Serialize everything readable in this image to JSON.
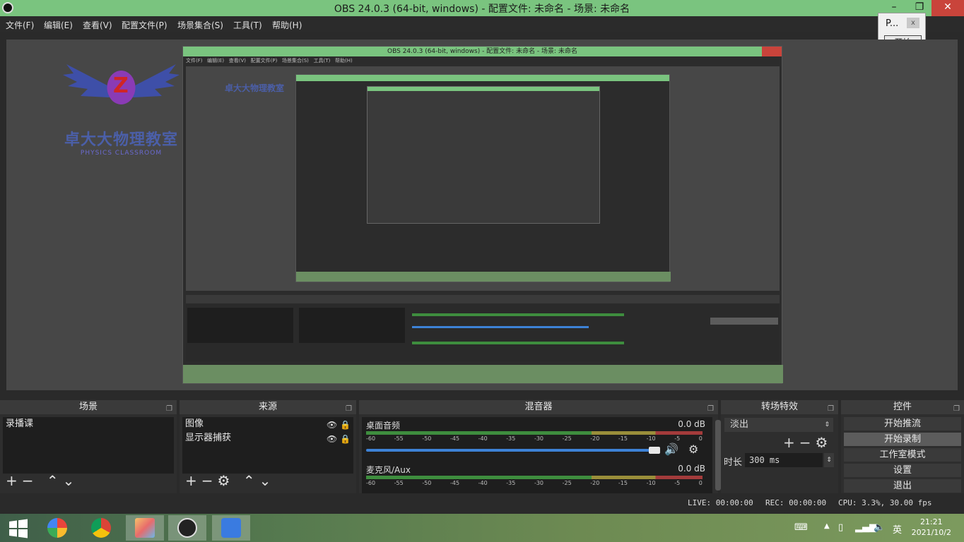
{
  "window": {
    "title": "OBS 24.0.3 (64-bit, windows) - 配置文件: 未命名 - 场景: 未命名"
  },
  "menu": [
    "文件(F)",
    "编辑(E)",
    "查看(V)",
    "配置文件(P)",
    "场景集合(S)",
    "工具(T)",
    "帮助(H)"
  ],
  "mini_window": {
    "title": "P...",
    "close": "x",
    "button": "开始"
  },
  "preview": {
    "logo_text": "卓大大物理教室",
    "logo_sub": "PHYSICS CLASSROOM",
    "logo_letter": "Z"
  },
  "scenes": {
    "header": "场景",
    "items": [
      "录播课"
    ]
  },
  "sources": {
    "header": "来源",
    "items": [
      "图像",
      "显示器捕获"
    ]
  },
  "mixer": {
    "header": "混音器",
    "channels": [
      {
        "name": "桌面音频",
        "level": "0.0 dB"
      },
      {
        "name": "麦克风/Aux",
        "level": "0.0 dB"
      }
    ],
    "scale": [
      "-60",
      "-55",
      "-50",
      "-45",
      "-40",
      "-35",
      "-30",
      "-25",
      "-20",
      "-15",
      "-10",
      "-5",
      "0"
    ]
  },
  "transitions": {
    "header": "转场特效",
    "selected": "淡出",
    "duration_label": "时长",
    "duration_value": "300 ms"
  },
  "controls": {
    "header": "控件",
    "buttons": [
      "开始推流",
      "开始录制",
      "工作室模式",
      "设置",
      "退出"
    ]
  },
  "status": {
    "live": "LIVE: 00:00:00",
    "rec": "REC: 00:00:00",
    "cpu": "CPU: 3.3%, 30.00 fps"
  },
  "taskbar": {
    "time": "21:21",
    "date": "2021/10/2",
    "ime": "英"
  },
  "colors": {
    "titlebar": "#7ac47f",
    "close": "#c9443b",
    "slider": "#3d82d6"
  }
}
